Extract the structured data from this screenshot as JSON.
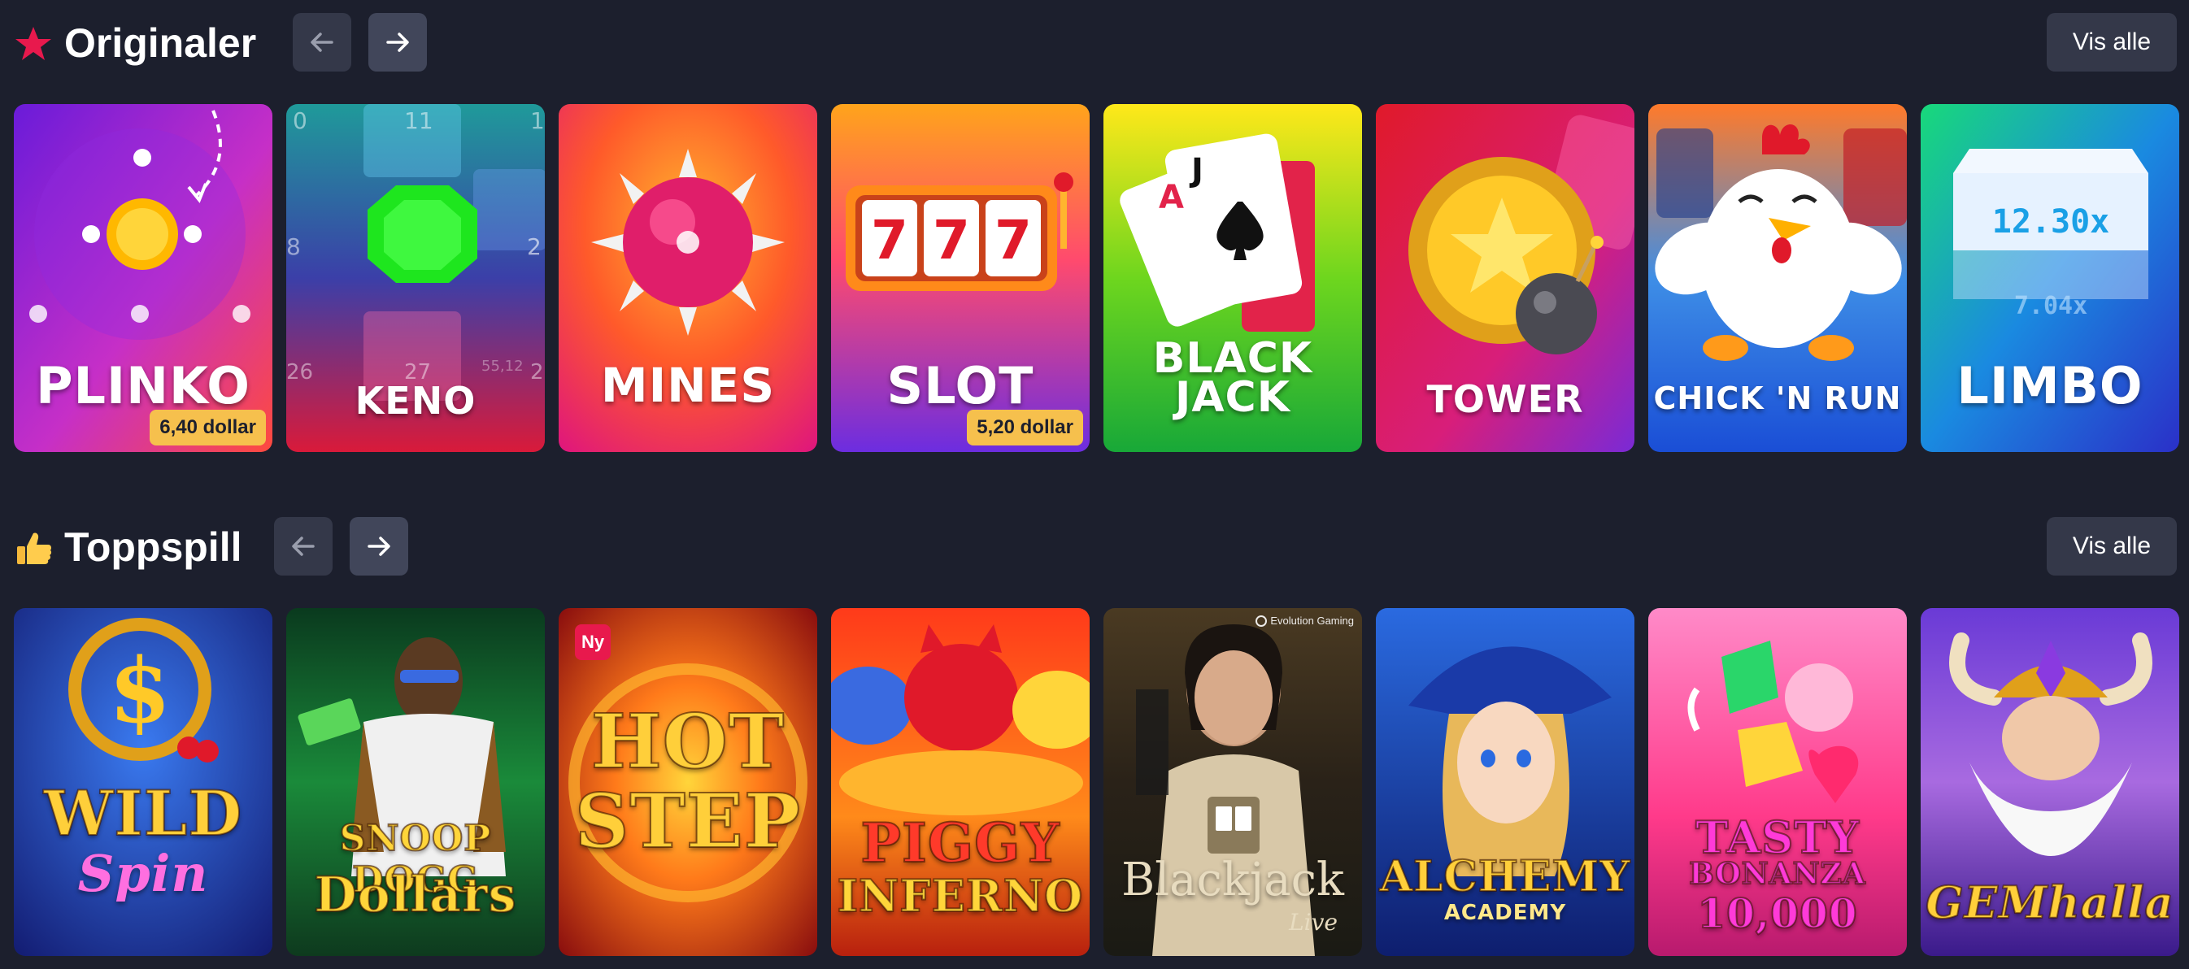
{
  "sections": [
    {
      "title": "Originaler",
      "icon": "star-icon",
      "view_all_label": "Vis alle",
      "cards": [
        {
          "title": "PLINKO",
          "badge": "6,40 dollar"
        },
        {
          "title": "KENO",
          "numbers": [
            "0",
            "11",
            "1",
            "8",
            "2",
            "26",
            "27",
            "55,12",
            "2"
          ]
        },
        {
          "title": "MINES"
        },
        {
          "title": "SLOT",
          "badge": "5,20 dollar",
          "reel_digits": [
            "7",
            "7",
            "7"
          ]
        },
        {
          "title_line1": "BLACK",
          "title_line2": "JACK",
          "card_letters": [
            "A",
            "J"
          ]
        },
        {
          "title": "TOWER"
        },
        {
          "title": "CHICK 'N RUN"
        },
        {
          "title": "LIMBO",
          "multiplier": "12.30x",
          "multiplier_faded": "7.04x"
        }
      ]
    },
    {
      "title": "Toppspill",
      "icon": "thumbs-up-icon",
      "view_all_label": "Vis alle",
      "cards": [
        {
          "title_line1": "WILD",
          "title_line2": "Spin"
        },
        {
          "title_line1": "SNOOP DOGG",
          "title_line2": "Dollars"
        },
        {
          "title_line1": "HOT",
          "title_line2": "STEP",
          "new_badge": "Ny"
        },
        {
          "title_line1": "PIGGY",
          "title_line2": "INFERNO"
        },
        {
          "title": "Blackjack",
          "subtitle": "Live",
          "provider": "Evolution Gaming"
        },
        {
          "title_line1": "ALCHEMY",
          "title_line2": "ACADEMY"
        },
        {
          "title_line1": "TASTY",
          "title_line2": "BONANZA",
          "title_line3": "10,000"
        },
        {
          "title": "GEMhalla"
        }
      ]
    }
  ],
  "colors": {
    "background": "#1c1f2d",
    "button": "#343849",
    "star": "#e8194d",
    "badge": "#f6c04d"
  }
}
